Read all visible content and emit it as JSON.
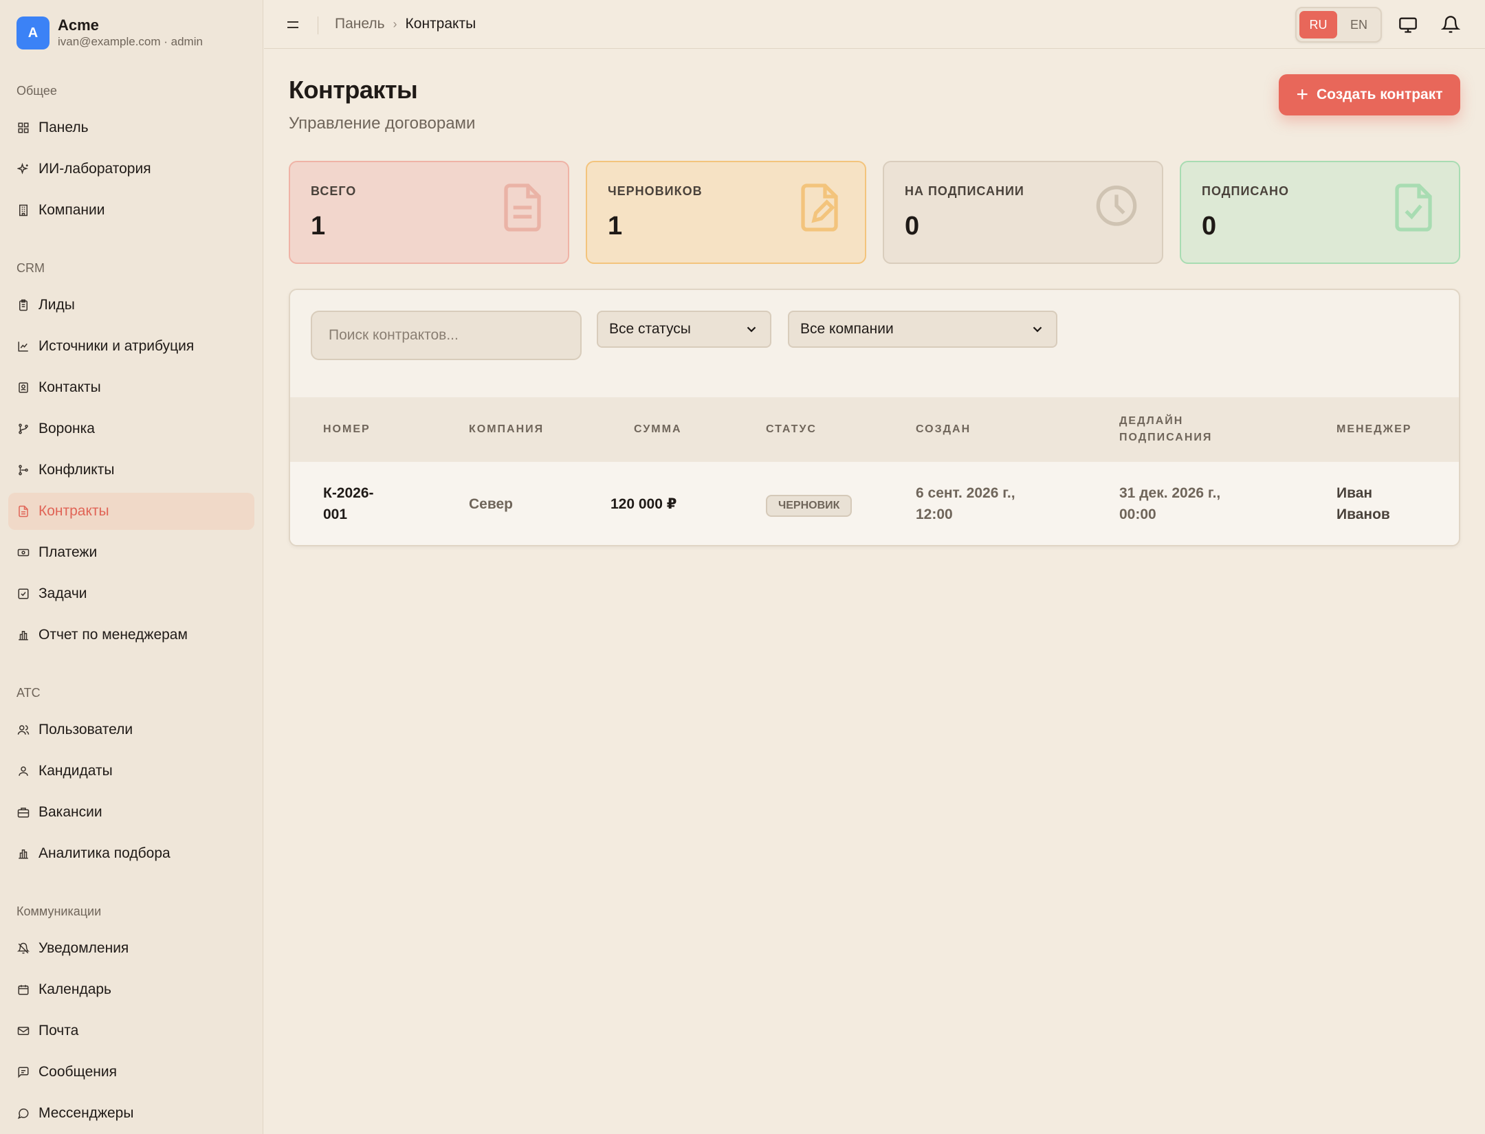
{
  "brand": {
    "initial": "A",
    "name": "Acme",
    "subtitle": "ivan@example.com · admin"
  },
  "sidebar": {
    "sections": [
      {
        "title": "Общее",
        "items": [
          {
            "label": "Панель",
            "icon": "grid-icon"
          },
          {
            "label": "ИИ-лаборатория",
            "icon": "sparkles-icon"
          },
          {
            "label": "Компании",
            "icon": "building-icon"
          }
        ]
      },
      {
        "title": "CRM",
        "items": [
          {
            "label": "Лиды",
            "icon": "clipboard-icon"
          },
          {
            "label": "Источники и атрибуция",
            "icon": "chart-line-icon"
          },
          {
            "label": "Контакты",
            "icon": "contact-card-icon"
          },
          {
            "label": "Воронка",
            "icon": "git-branch-icon"
          },
          {
            "label": "Конфликты",
            "icon": "git-merge-icon"
          },
          {
            "label": "Контракты",
            "icon": "file-text-icon",
            "active": true
          },
          {
            "label": "Платежи",
            "icon": "banknote-icon"
          },
          {
            "label": "Задачи",
            "icon": "checkbox-icon"
          },
          {
            "label": "Отчет по менеджерам",
            "icon": "bar-chart-icon"
          }
        ]
      },
      {
        "title": "ATC",
        "items": [
          {
            "label": "Пользователи",
            "icon": "users-icon"
          },
          {
            "label": "Кандидаты",
            "icon": "user-icon"
          },
          {
            "label": "Вакансии",
            "icon": "briefcase-icon"
          },
          {
            "label": "Аналитика подбора",
            "icon": "bar-chart-icon"
          }
        ]
      },
      {
        "title": "Коммуникации",
        "items": [
          {
            "label": "Уведомления",
            "icon": "bell-off-icon"
          },
          {
            "label": "Календарь",
            "icon": "calendar-icon"
          },
          {
            "label": "Почта",
            "icon": "mail-icon"
          },
          {
            "label": "Сообщения",
            "icon": "message-square-icon"
          },
          {
            "label": "Мессенджеры",
            "icon": "message-circle-icon"
          }
        ]
      }
    ]
  },
  "topbar": {
    "breadcrumb": {
      "parent": "Панель",
      "separator": "›",
      "current": "Контракты"
    },
    "lang": {
      "ru": "RU",
      "en": "EN",
      "active": "RU"
    }
  },
  "page": {
    "title": "Контракты",
    "subtitle": "Управление договорами",
    "create_button": "Создать контракт"
  },
  "stats": [
    {
      "label": "ВСЕГО",
      "value": "1",
      "icon": "file-text-icon"
    },
    {
      "label": "ЧЕРНОВИКОВ",
      "value": "1",
      "icon": "file-edit-icon"
    },
    {
      "label": "НА ПОДПИСАНИИ",
      "value": "0",
      "icon": "clock-icon"
    },
    {
      "label": "ПОДПИСАНО",
      "value": "0",
      "icon": "file-check-icon"
    }
  ],
  "filters": {
    "search_placeholder": "Поиск контрактов...",
    "status": "Все статусы",
    "company": "Все компании"
  },
  "table": {
    "headers": {
      "number": "НОМЕР",
      "company": "КОМПАНИЯ",
      "amount": "СУММА",
      "status": "СТАТУС",
      "created": "СОЗДАН",
      "deadline_1": "ДЕДЛАЙН",
      "deadline_2": "ПОДПИСАНИЯ",
      "manager": "МЕНЕДЖЕР"
    },
    "rows": [
      {
        "number_1": "К-2026-",
        "number_2": "001",
        "company": "Север",
        "amount": "120 000 ₽",
        "status": "ЧЕРНОВИК",
        "created_1": "6 сент. 2026 г.,",
        "created_2": "12:00",
        "deadline_1": "31 дек. 2026 г.,",
        "deadline_2": "00:00",
        "manager_1": "Иван",
        "manager_2": "Иванов"
      }
    ]
  },
  "colors": {
    "accent": "#e8675a",
    "background": "#f3ebdf",
    "sidebar": "#efe6d9",
    "brand_avatar": "#3b82f6"
  }
}
